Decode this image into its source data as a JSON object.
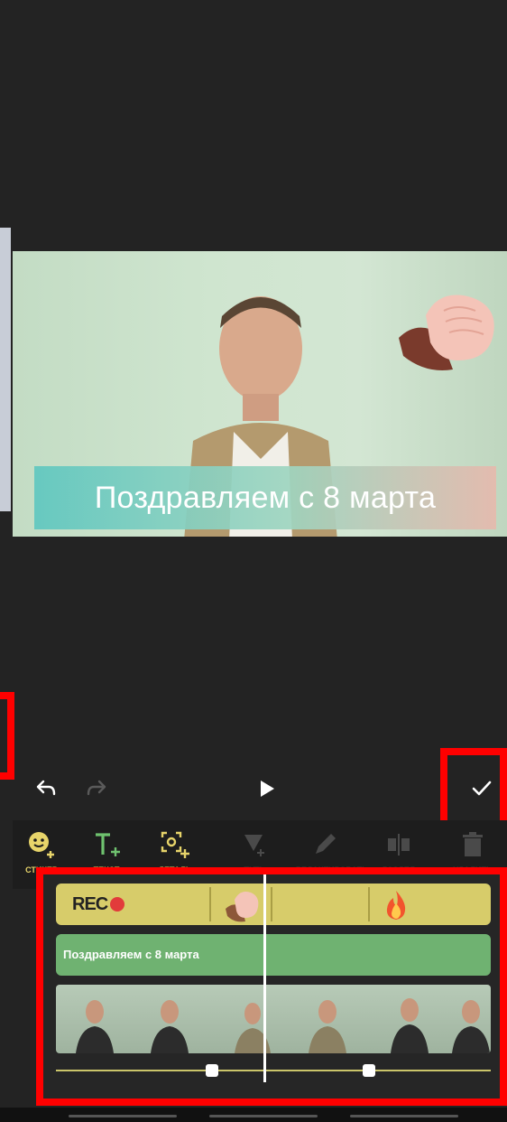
{
  "preview": {
    "caption": "Поздравляем с 8 марта",
    "caption_colors": [
      "#5fc7c0",
      "#e6b9ad"
    ]
  },
  "controls": {
    "undo_icon": "undo-icon",
    "redo_icon": "redo-icon",
    "play_icon": "play-icon",
    "confirm_icon": "checkmark-icon"
  },
  "tools": [
    {
      "label": "СТИКЕР",
      "icon": "sticker-add-icon",
      "active": true
    },
    {
      "label": "ТЕКСТ",
      "icon": "text-add-icon",
      "active": true
    },
    {
      "label": "ДЕТАЛЬ",
      "icon": "detail-add-icon",
      "active": true
    },
    {
      "label": "ПУТЬ",
      "icon": "path-icon",
      "active": false
    },
    {
      "label": "РЕДАКТИРОВАТЬ",
      "icon": "pencil-icon",
      "active": false
    },
    {
      "label": "РАЗДЕЛ",
      "icon": "split-icon",
      "active": false
    },
    {
      "label": "УДАЛИТЬ",
      "icon": "trash-icon",
      "active": false
    }
  ],
  "timeline": {
    "sticker_track": {
      "rec_label": "REC",
      "stickers": [
        "rec-sticker",
        "hand-sticker",
        "fire-sticker"
      ]
    },
    "text_track": {
      "label": "Поздравляем с 8 марта"
    },
    "video_track": {
      "frames": 6
    }
  },
  "accent_color": "#e7d46a",
  "highlight_color": "#ff0000"
}
